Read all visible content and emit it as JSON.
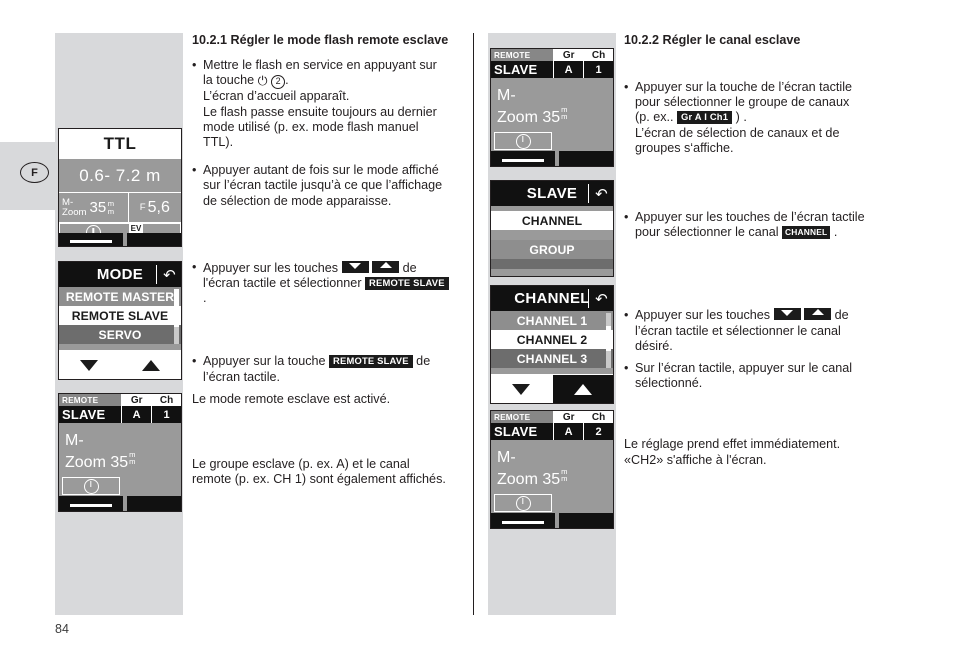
{
  "page": {
    "number": "84",
    "language_marker": "F"
  },
  "left_column": {
    "heading": "10.2.1 Régler le mode flash remote esclave",
    "blocks": [
      {
        "bullet": true,
        "lines": [
          "Mettre le flash en service en appuyant sur",
          "la touche ⏻ ②.",
          "L’écran d’accueil apparaît.",
          "Le flash passe ensuite toujours au dernier",
          "mode utilisé (p. ex. mode flash manuel",
          "TTL)."
        ]
      },
      {
        "bullet": true,
        "lines": [
          "Appuyer autant de fois sur le mode affiché",
          "sur l’écran tactile jusqu’à ce que l’affichage",
          "de sélection de mode apparaisse."
        ]
      },
      {
        "bullet": true,
        "lines": [
          "Appuyer sur les touches ▼ ▲ de",
          "l'écran tactile et sélectionner REMOTE SLAVE",
          "."
        ]
      },
      {
        "bullet": true,
        "lines": [
          "Appuyer sur la touche REMOTE SLAVE de",
          "l’écran tactile."
        ]
      },
      {
        "bullet": false,
        "lines": [
          "Le mode remote esclave est activé."
        ]
      },
      {
        "bullet": false,
        "lines": [
          "Le groupe esclave (p. ex. A) et le canal",
          "remote (p. ex. CH 1) sont également affichés."
        ]
      }
    ],
    "chips": {
      "remote_slave": "REMOTE SLAVE"
    }
  },
  "right_column": {
    "heading": "10.2.2 Régler le canal esclave",
    "blocks": [
      {
        "bullet": true,
        "lines": [
          "Appuyer sur la touche de l’écran tactile",
          "pour sélectionner le groupe de canaux",
          "(p. ex.. Gr A I Ch1 ) .",
          "L’écran de sélection de canaux et de",
          "groupes s‘affiche."
        ]
      },
      {
        "bullet": true,
        "lines": [
          "Appuyer sur les touches de l’écran tactile",
          "pour sélectionner le canal CHANNEL ."
        ]
      },
      {
        "bullet": true,
        "lines": [
          "Appuyer sur les touches ▼ ▲ de",
          "l’écran tactile et sélectionner le canal",
          "désiré."
        ]
      },
      {
        "bullet": true,
        "lines": [
          "Sur l’écran tactile, appuyer sur le canal",
          "sélectionné."
        ]
      },
      {
        "bullet": false,
        "lines": [
          "Le réglage prend effet immédiatement.",
          "«CH2» s'affiche à l'écran."
        ]
      }
    ],
    "chips": {
      "gr_ch": "Gr A I Ch1",
      "channel": "CHANNEL"
    }
  },
  "screens": {
    "ttl_home": {
      "mode": "TTL",
      "distance": "0.6- 7.2 m",
      "zoom_label_line1": "M-",
      "zoom_label_line2": "Zoom",
      "zoom_value": "35",
      "zoom_unit_line1": "m",
      "zoom_unit_line2": "m",
      "aperture_prefix": "F",
      "aperture_value": "5,6",
      "ev_label": "EV"
    },
    "mode_menu": {
      "title": "MODE",
      "back_icon": "back-arrow-icon",
      "items": [
        "REMOTE MASTER",
        "REMOTE SLAVE",
        "SERVO"
      ],
      "selected": "REMOTE SLAVE",
      "nav_down": "down-arrow-icon",
      "nav_up": "up-arrow-icon"
    },
    "slave_menu": {
      "title": "SLAVE",
      "back_icon": "back-arrow-icon",
      "items": [
        "CHANNEL",
        "GROUP"
      ],
      "selected": "CHANNEL"
    },
    "channel_menu": {
      "title": "CHANNEL",
      "back_icon": "back-arrow-icon",
      "items": [
        "CHANNEL 1",
        "CHANNEL 2",
        "CHANNEL 3"
      ],
      "selected": "CHANNEL 2",
      "nav_down": "down-arrow-icon",
      "nav_up": "up-arrow-icon"
    },
    "remote_slave_ch1": {
      "remote_label": "REMOTE",
      "slave_label": "SLAVE",
      "gr_header": "Gr",
      "gr_value": "A",
      "ch_header": "Ch",
      "ch_value": "1",
      "zoom_line1": "M-",
      "zoom_line2": "Zoom",
      "zoom_value": "35",
      "zoom_unit_line1": "m",
      "zoom_unit_line2": "m"
    },
    "remote_slave_ch1_mid": {
      "remote_label": "REMOTE",
      "slave_label": "SLAVE",
      "gr_header": "Gr",
      "gr_value": "A",
      "ch_header": "Ch",
      "ch_value": "1",
      "zoom_line1": "M-",
      "zoom_line2": "Zoom",
      "zoom_value": "35",
      "zoom_unit_line1": "m",
      "zoom_unit_line2": "m"
    },
    "remote_slave_ch2": {
      "remote_label": "REMOTE",
      "slave_label": "SLAVE",
      "gr_header": "Gr",
      "gr_value": "A",
      "ch_header": "Ch",
      "ch_value": "2",
      "zoom_line1": "M-",
      "zoom_line2": "Zoom",
      "zoom_value": "35",
      "zoom_unit_line1": "m",
      "zoom_unit_line2": "m"
    }
  },
  "colors": {
    "page_bg": "#ffffff",
    "panel_gray": "#d8d9db",
    "lcd_gray": "#9a9a9a",
    "lcd_black": "#111111",
    "text": "#231f20"
  }
}
